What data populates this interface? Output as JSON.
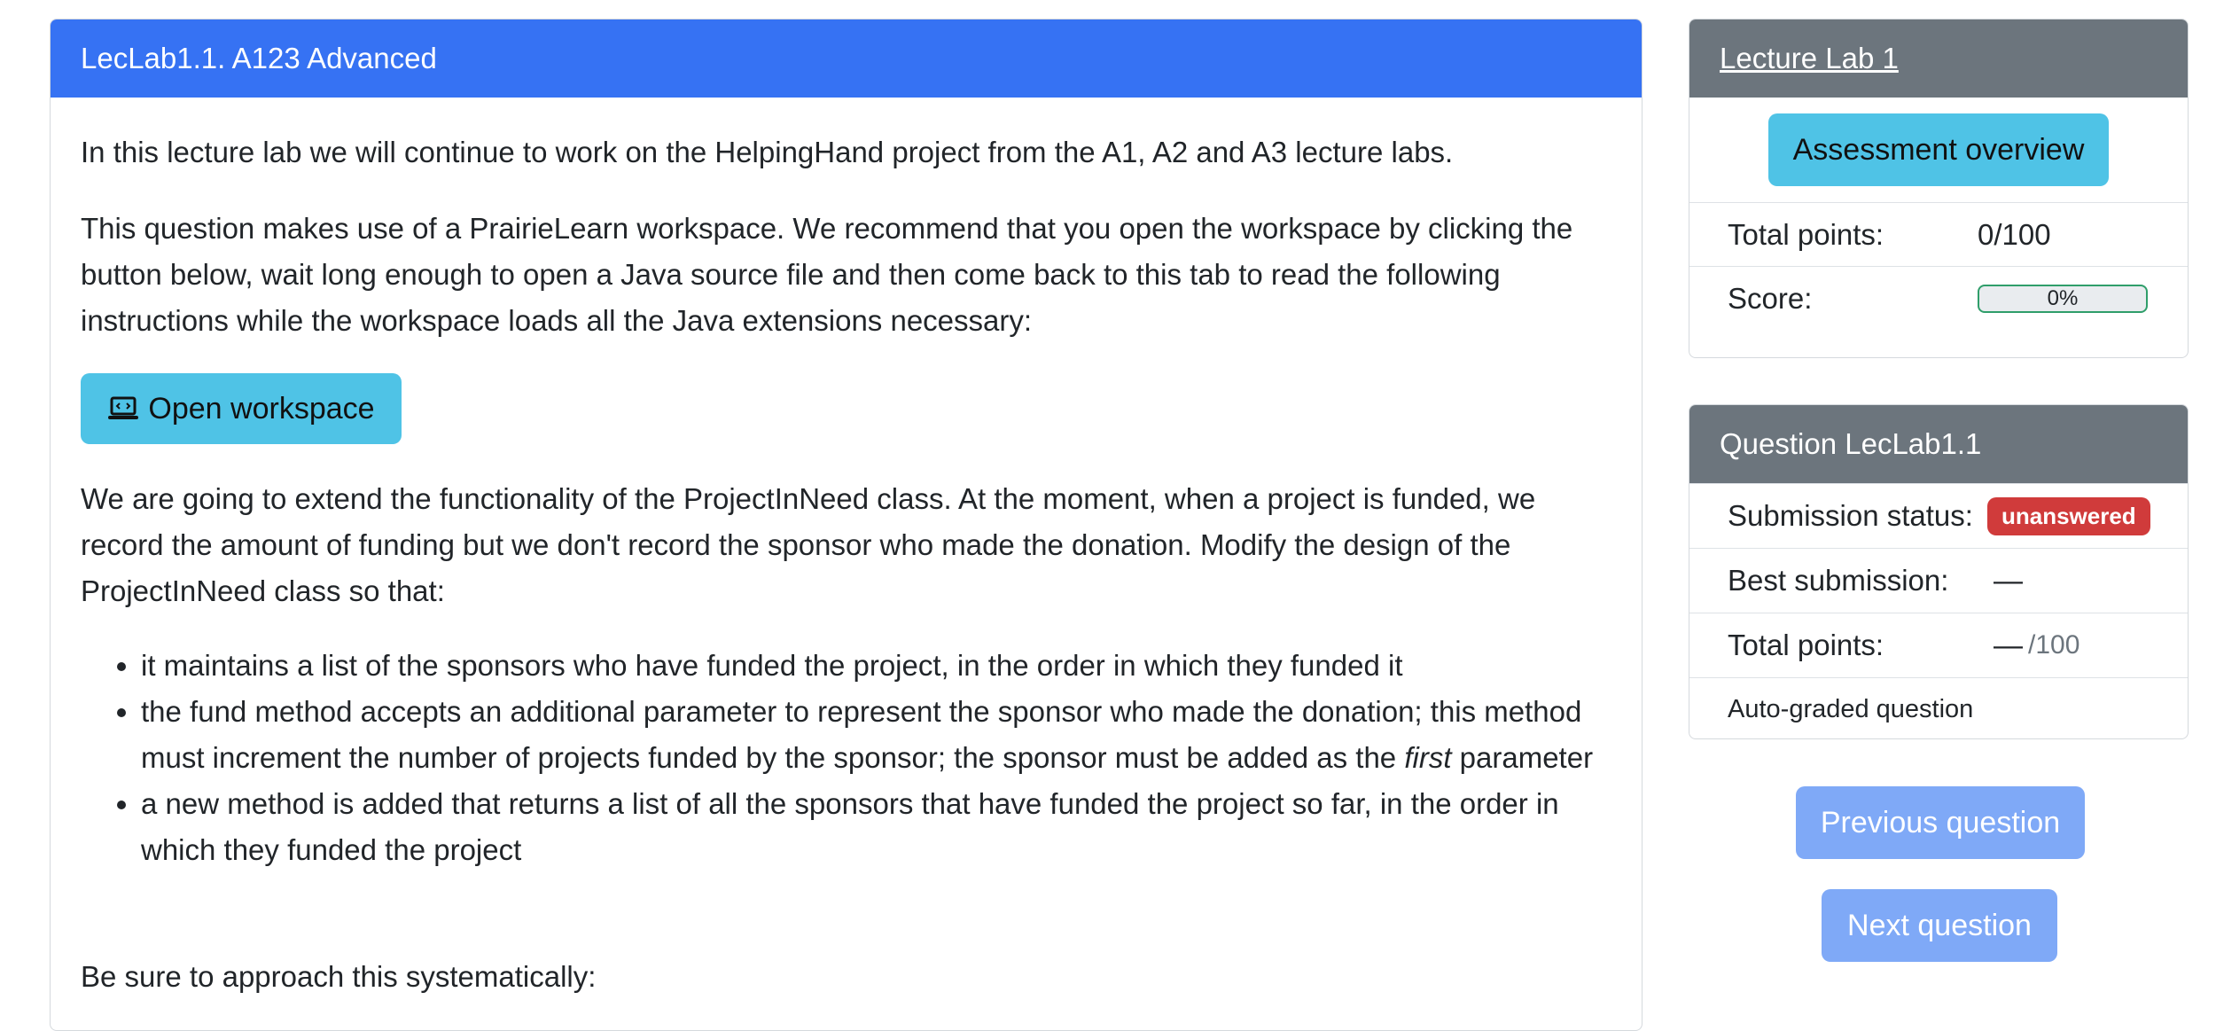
{
  "main": {
    "title": "LecLab1.1. A123 Advanced",
    "intro": "In this lecture lab we will continue to work on the HelpingHand project from the A1, A2 and A3 lecture labs.",
    "workspace_note": "This question makes use of a PrairieLearn workspace. We recommend that you open the workspace by clicking the button below, wait long enough to open a Java source file and then come back to this tab to read the following instructions while the workspace loads all the Java extensions necessary:",
    "open_workspace_label": "Open workspace",
    "extend_text": "We are going to extend the functionality of the ProjectInNeed class. At the moment, when a project is funded, we record the amount of funding but we don't record the sponsor who made the donation. Modify the design of the ProjectInNeed class so that:",
    "bullets": {
      "b1": "it maintains a list of the sponsors who have funded the project, in the order in which they funded it",
      "b2_pre": "the fund method accepts an additional parameter to represent the sponsor who made the donation; this method must increment the number of projects funded by the sponsor; the sponsor must be added as the ",
      "b2_em": "first",
      "b2_post": " parameter",
      "b3": "a new method is added that returns a list of all the sponsors that have funded the project so far, in the order in which they funded the project"
    },
    "closing": "Be sure to approach this systematically:"
  },
  "assessment": {
    "title": "Lecture Lab 1",
    "overview_label": "Assessment overview",
    "total_points_label": "Total points:",
    "total_points_value": "0/100",
    "score_label": "Score:",
    "score_value": "0%"
  },
  "question": {
    "title": "Question LecLab1.1",
    "status_label": "Submission status:",
    "status_badge": "unanswered",
    "best_label": "Best submission:",
    "best_value": "—",
    "points_label": "Total points:",
    "points_value": "—",
    "points_max": "/100",
    "autograded": "Auto-graded question"
  },
  "nav": {
    "previous": "Previous question",
    "next": "Next question"
  },
  "colors": {
    "primary_header": "#3672f3",
    "secondary_header": "#6c757d",
    "info_button": "#4fc3e6",
    "danger_badge": "#d03b3b",
    "nav_button": "#7fa9f7"
  }
}
